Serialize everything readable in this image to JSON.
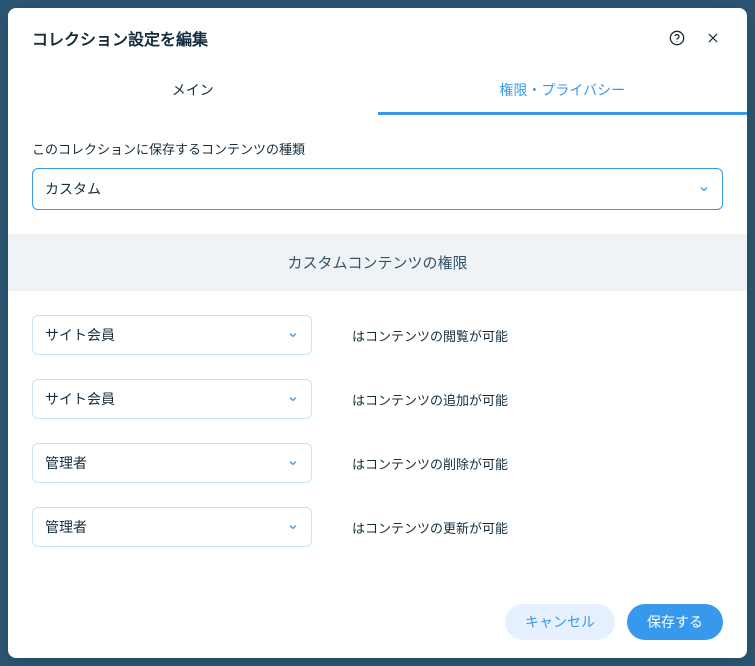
{
  "modal": {
    "title": "コレクション設定を編集"
  },
  "tabs": {
    "main": "メイン",
    "privacy": "権限・プライバシー"
  },
  "contentType": {
    "label": "このコレクションに保存するコンテンツの種類",
    "value": "カスタム"
  },
  "banner": "カスタムコンテンツの権限",
  "permissions": [
    {
      "role": "サイト会員",
      "desc": "はコンテンツの閲覧が可能"
    },
    {
      "role": "サイト会員",
      "desc": "はコンテンツの追加が可能"
    },
    {
      "role": "管理者",
      "desc": "はコンテンツの削除が可能"
    },
    {
      "role": "管理者",
      "desc": "はコンテンツの更新が可能"
    }
  ],
  "footer": {
    "cancel": "キャンセル",
    "save": "保存する"
  }
}
